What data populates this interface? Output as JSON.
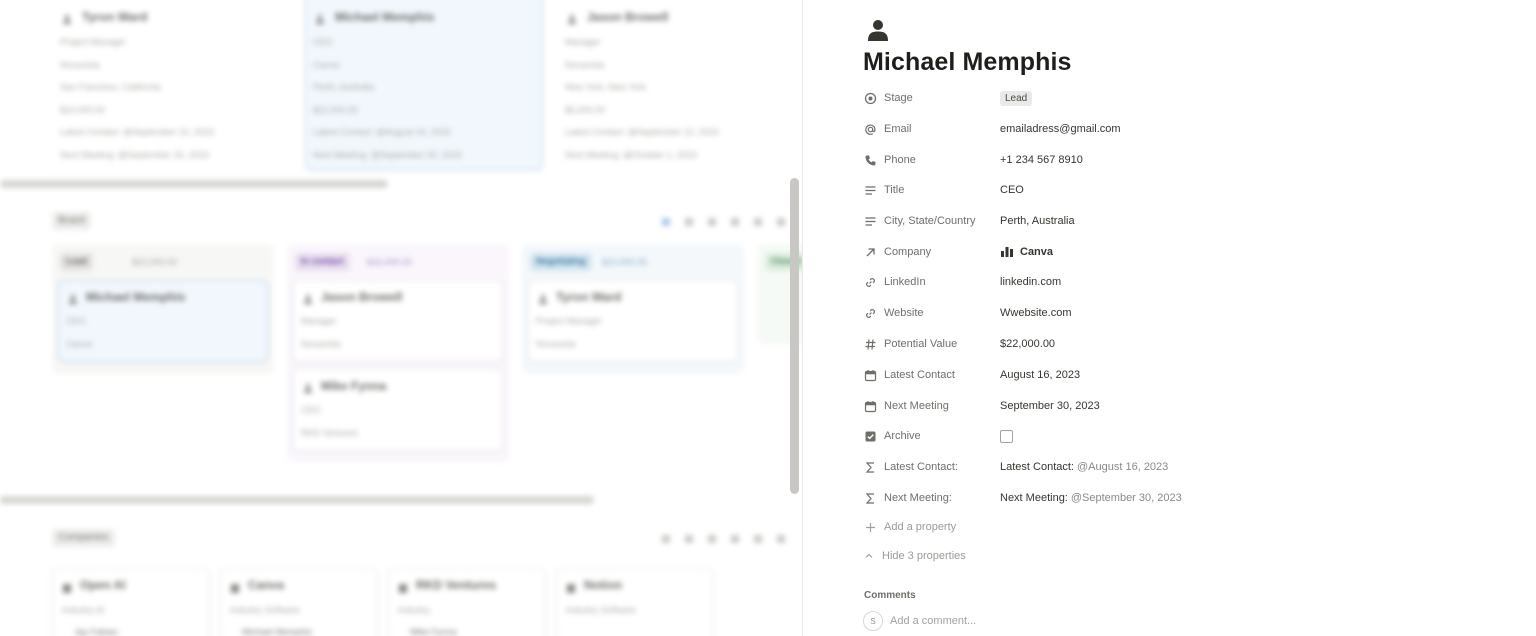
{
  "background": {
    "people_cards": [
      {
        "name": "Tyron Ward",
        "lines": [
          "Project Manager",
          "Nocavista",
          "San Francisco, California",
          "$10,000.00",
          "Latest Contact: @September 10, 2023",
          "Next Meeting: @September 20, 2023"
        ]
      },
      {
        "name": "Michael Memphis",
        "lines": [
          "CEO",
          "Canva",
          "Perth, Australia",
          "$22,000.00",
          "Latest Contact: @August 16, 2023",
          "Next Meeting: @September 30, 2023"
        ]
      },
      {
        "name": "Jason Browell",
        "lines": [
          "Manager",
          "Nocavista",
          "New York, New York",
          "$5,000.00",
          "Latest Contact: @September 12, 2023",
          "Next Meeting: @October 1, 2023"
        ]
      }
    ],
    "board_label": "Board",
    "columns": [
      {
        "label": "Lead",
        "total": "$22,000.00",
        "chip_bg": "#e3e2e0",
        "chip_fg": "#5f5e5a",
        "bg": "#f7f7f5",
        "cards": [
          {
            "name": "Michael Memphis",
            "lines": [
              "CEO",
              "Canva"
            ],
            "selected": true
          }
        ]
      },
      {
        "label": "In contact",
        "total": "$16,000.00",
        "chip_bg": "#e8deee",
        "chip_fg": "#6940a5",
        "bg": "#faf6fc",
        "cards": [
          {
            "name": "Jason Browell",
            "lines": [
              "Manager",
              "Nocavista"
            ],
            "selected": false
          },
          {
            "name": "Mike Fynna",
            "lines": [
              "CEO",
              "RKD Ventures"
            ],
            "selected": false
          }
        ]
      },
      {
        "label": "Negotiating",
        "total": "$10,000.00",
        "chip_bg": "#d3e5ef",
        "chip_fg": "#2e6e9e",
        "bg": "#f4f8fb",
        "cards": [
          {
            "name": "Tyron Ward",
            "lines": [
              "Project Manager",
              "Nocavista"
            ],
            "selected": false
          }
        ]
      },
      {
        "label": "Closed",
        "total": "",
        "chip_bg": "#dbeddb",
        "chip_fg": "#448361",
        "bg": "#f6faf6",
        "cards": []
      }
    ],
    "companies_label": "Companies",
    "company_cards": [
      {
        "name": "Open AI",
        "industry": "Industry AI",
        "person": "Jay Fabian"
      },
      {
        "name": "Canva",
        "industry": "Industry Software",
        "person": "Michael Memphis"
      },
      {
        "name": "RKD Ventures",
        "industry": "Industry",
        "person": "Mike Fynna"
      },
      {
        "name": "Notion",
        "industry": "Industry Software",
        "person": ""
      }
    ]
  },
  "page": {
    "icon": "person-icon",
    "title": "Michael Memphis"
  },
  "properties": [
    {
      "key": "stage",
      "icon": "status-icon",
      "name": "Stage",
      "value": "Lead",
      "kind": "tag"
    },
    {
      "key": "email",
      "icon": "at-icon",
      "name": "Email",
      "value": "emailadress@gmail.com",
      "kind": "text"
    },
    {
      "key": "phone",
      "icon": "phone-icon",
      "name": "Phone",
      "value": "+1 234 567 8910",
      "kind": "text"
    },
    {
      "key": "title",
      "icon": "text-lines-icon",
      "name": "Title",
      "value": "CEO",
      "kind": "text"
    },
    {
      "key": "city",
      "icon": "text-lines-icon",
      "name": "City, State/Country",
      "value": "Perth, Australia",
      "kind": "text"
    },
    {
      "key": "company",
      "icon": "relation-arrow-icon",
      "name": "Company",
      "value": "Canva",
      "kind": "relation"
    },
    {
      "key": "linkedin",
      "icon": "link-icon",
      "name": "LinkedIn",
      "value": "linkedin.com",
      "kind": "text"
    },
    {
      "key": "website",
      "icon": "link-icon",
      "name": "Website",
      "value": "Wwebsite.com",
      "kind": "text"
    },
    {
      "key": "potential_value",
      "icon": "hash-icon",
      "name": "Potential Value",
      "value": "$22,000.00",
      "kind": "text"
    },
    {
      "key": "latest_contact",
      "icon": "calendar-icon",
      "name": "Latest Contact",
      "value": "August 16, 2023",
      "kind": "text"
    },
    {
      "key": "next_meeting",
      "icon": "calendar-icon",
      "name": "Next Meeting",
      "value": "September 30, 2023",
      "kind": "text"
    },
    {
      "key": "archive",
      "icon": "checkbox-icon",
      "name": "Archive",
      "value": "",
      "kind": "checkbox",
      "checked": false
    },
    {
      "key": "latest_contact_formula",
      "icon": "sigma-icon",
      "name": "Latest Contact:",
      "value_prefix": "Latest Contact:",
      "value": "@August 16, 2023",
      "kind": "formula"
    },
    {
      "key": "next_meeting_formula",
      "icon": "sigma-icon",
      "name": "Next Meeting:",
      "value_prefix": "Next Meeting:",
      "value": "@September 30, 2023",
      "kind": "formula"
    }
  ],
  "actions": {
    "add_property": "Add a property",
    "hide_properties": "Hide 3 properties"
  },
  "comments": {
    "label": "Comments",
    "avatar_initial": "S",
    "placeholder": "Add a comment..."
  }
}
